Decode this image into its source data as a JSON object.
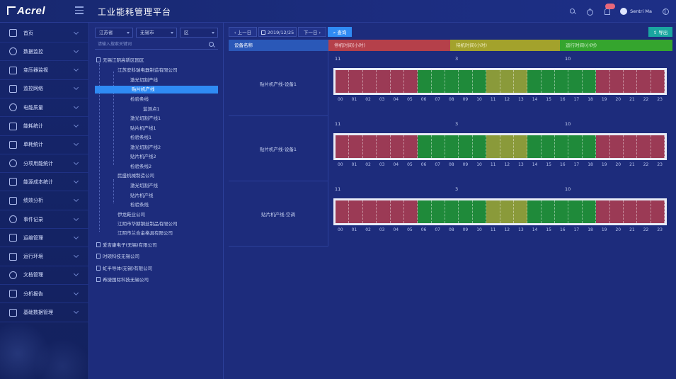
{
  "header": {
    "brand": "Acrel",
    "title": "工业能耗管理平台",
    "notification_count": "",
    "user_name": "Sentri Ma"
  },
  "colors": {
    "stop": "#9b3a55",
    "standby": "#8a9a3a",
    "run": "#1f8a3a",
    "accent": "#2f8bf4"
  },
  "sidebar": {
    "items": [
      {
        "label": "首页",
        "icon": "monitor-icon"
      },
      {
        "label": "数据监控",
        "icon": "chart-monitor-icon"
      },
      {
        "label": "变压器监视",
        "icon": "transformer-icon"
      },
      {
        "label": "监控网络",
        "icon": "network-icon"
      },
      {
        "label": "电能质量",
        "icon": "shield-icon"
      },
      {
        "label": "能耗统计",
        "icon": "bar-chart-icon"
      },
      {
        "label": "单耗统计",
        "icon": "nodes-icon"
      },
      {
        "label": "分项用能统计",
        "icon": "bulb-icon"
      },
      {
        "label": "能源成本统计",
        "icon": "cost-icon"
      },
      {
        "label": "绩效分析",
        "icon": "analysis-icon"
      },
      {
        "label": "事件记录",
        "icon": "record-icon"
      },
      {
        "label": "运维管理",
        "icon": "maintenance-icon"
      },
      {
        "label": "运行环境",
        "icon": "environment-icon"
      },
      {
        "label": "文档管理",
        "icon": "document-icon"
      },
      {
        "label": "分析报告",
        "icon": "report-icon"
      },
      {
        "label": "基础数据管理",
        "icon": "database-icon"
      }
    ]
  },
  "filters": {
    "province": "江苏省",
    "city": "无锡市",
    "district": "区",
    "search_placeholder": "请输入搜索关键词"
  },
  "tree": [
    {
      "label": "无锡江阴高新区园区",
      "level": 0,
      "icon": true
    },
    {
      "label": "江苏安科瑞电器制造有限公司",
      "level": 1
    },
    {
      "label": "激光切割产线",
      "level": 2
    },
    {
      "label": "贴片机产线",
      "level": 2,
      "selected": true
    },
    {
      "label": "检验条线",
      "level": 2
    },
    {
      "label": "监测点1",
      "level": 3
    },
    {
      "label": "激光切割产线1",
      "level": 2
    },
    {
      "label": "贴片机产线1",
      "level": 2
    },
    {
      "label": "检验条线1",
      "level": 2
    },
    {
      "label": "激光切割产线2",
      "level": 2
    },
    {
      "label": "贴片机产线2",
      "level": 2
    },
    {
      "label": "检验条线2",
      "level": 2
    },
    {
      "label": "民盛机械制造公司",
      "level": 1
    },
    {
      "label": "激光切割产线",
      "level": 2
    },
    {
      "label": "贴片机产线",
      "level": 2
    },
    {
      "label": "检验条线",
      "level": 2
    },
    {
      "label": "伊龙鞋业公司",
      "level": 1
    },
    {
      "label": "江阴市华赫钢丝制品有限公司",
      "level": 1
    },
    {
      "label": "江阴市兰合金格具有限公司",
      "level": 1
    },
    {
      "label": "爱吉康电子(无锡)有限公司",
      "level": 0,
      "icon": true
    },
    {
      "label": "时硕科技无锡公司",
      "level": 0,
      "icon": true
    },
    {
      "label": "虹半导体(无锡)有限公司",
      "level": 0,
      "icon": true
    },
    {
      "label": "希捷国际科技无锡公司",
      "level": 0,
      "icon": true
    }
  ],
  "toolbar": {
    "prev_label": "上一日",
    "date": "2019/12/25",
    "next_label": "下一日",
    "query_label": "查询",
    "export_label": "导出"
  },
  "table": {
    "headers": {
      "name": "设备名称",
      "stop": "停机时间(小时)",
      "standby": "待机时间(小时)",
      "run": "运行时间(小时)"
    },
    "hours": [
      "00",
      "01",
      "02",
      "03",
      "04",
      "05",
      "06",
      "07",
      "08",
      "09",
      "10",
      "11",
      "12",
      "13",
      "14",
      "15",
      "16",
      "17",
      "18",
      "19",
      "20",
      "21",
      "22",
      "23"
    ],
    "rows": [
      {
        "name": "贴片机产线-设备1",
        "stop": "11",
        "standby": "3",
        "run": "10",
        "states": [
          "stop",
          "stop",
          "stop",
          "stop",
          "stop",
          "stop",
          "run",
          "run",
          "run",
          "run",
          "run",
          "standby",
          "standby",
          "standby",
          "run",
          "run",
          "run",
          "run",
          "run",
          "stop",
          "stop",
          "stop",
          "stop",
          "stop"
        ]
      },
      {
        "name": "贴片机产线-设备1",
        "stop": "11",
        "standby": "3",
        "run": "10",
        "states": [
          "stop",
          "stop",
          "stop",
          "stop",
          "stop",
          "stop",
          "run",
          "run",
          "run",
          "run",
          "run",
          "standby",
          "standby",
          "standby",
          "run",
          "run",
          "run",
          "run",
          "run",
          "stop",
          "stop",
          "stop",
          "stop",
          "stop"
        ]
      },
      {
        "name": "贴片机产线-空调",
        "stop": "11",
        "standby": "3",
        "run": "10",
        "states": [
          "stop",
          "stop",
          "stop",
          "stop",
          "stop",
          "stop",
          "run",
          "run",
          "run",
          "run",
          "run",
          "standby",
          "standby",
          "standby",
          "run",
          "run",
          "run",
          "run",
          "run",
          "stop",
          "stop",
          "stop",
          "stop",
          "stop"
        ]
      }
    ]
  }
}
